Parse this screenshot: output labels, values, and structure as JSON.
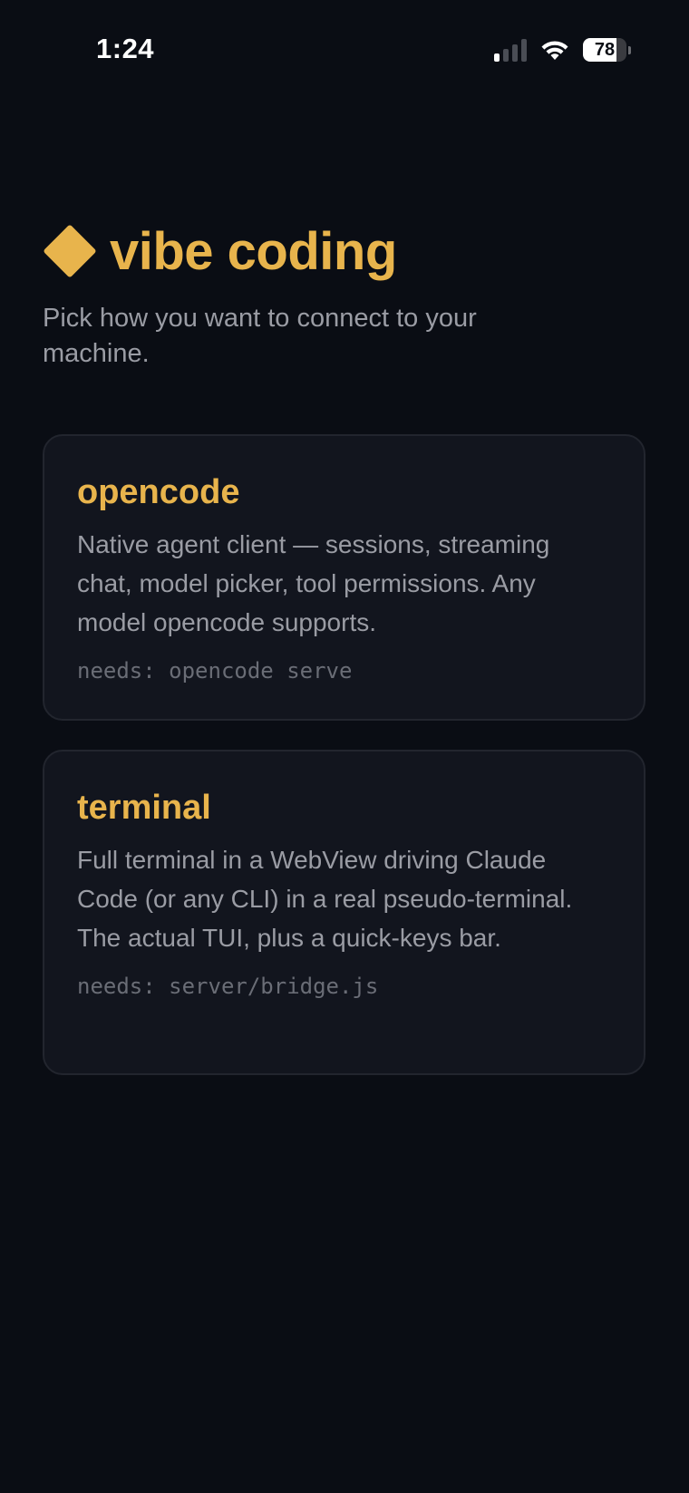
{
  "status_bar": {
    "time": "1:24",
    "battery_level": "78",
    "signal_bars_active": 1,
    "signal_bars_total": 4
  },
  "header": {
    "icon": "diamond-icon",
    "title": "vibe coding",
    "subtitle": "Pick how you want to connect to your machine."
  },
  "options": [
    {
      "title": "opencode",
      "description": "Native agent client — sessions, streaming chat, model picker, tool permissions. Any model opencode supports.",
      "needs": "needs: opencode serve"
    },
    {
      "title": "terminal",
      "description": "Full terminal in a WebView driving Claude Code (or any CLI) in a real pseudo-terminal. The actual TUI, plus a quick-keys bar.",
      "needs": "needs: server/bridge.js"
    }
  ],
  "colors": {
    "background": "#0a0d14",
    "accent": "#e8b44c",
    "card_background": "#12151e",
    "card_border": "#22252e",
    "text_muted": "#9a9ca4",
    "text_mono": "#6a6d76"
  }
}
